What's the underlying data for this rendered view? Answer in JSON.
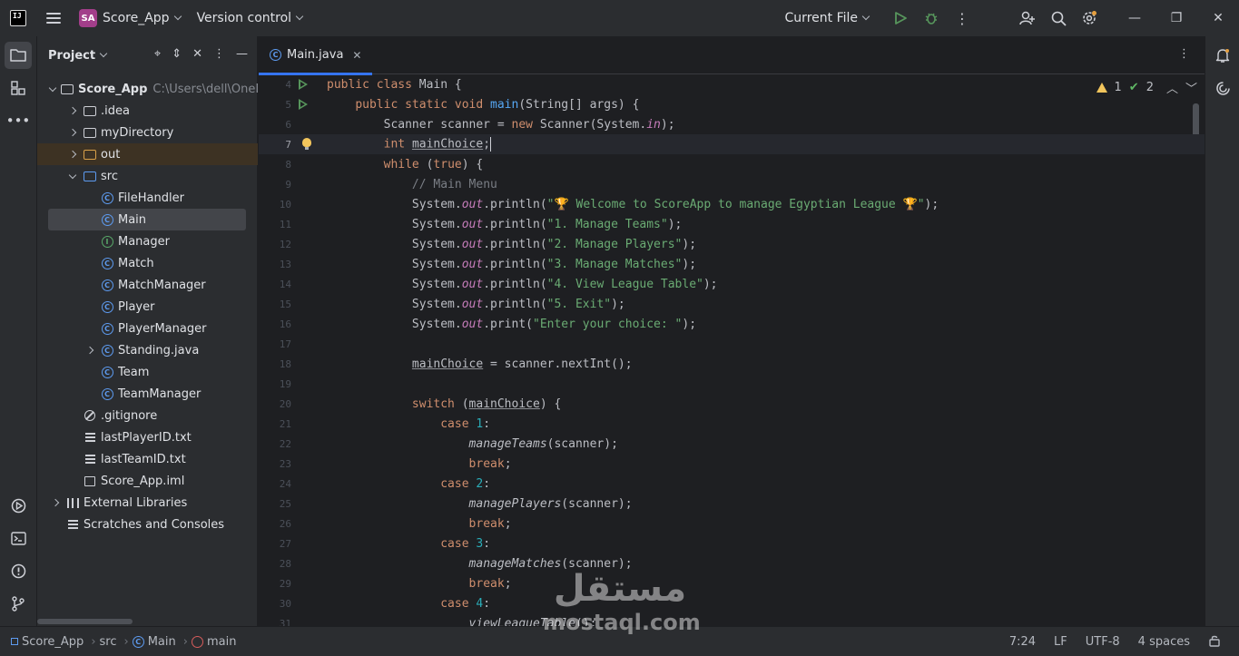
{
  "titlebar": {
    "logo": "IJ",
    "project_badge": "SA",
    "project_name": "Score_App",
    "vcs": "Version control",
    "run_config": "Current File"
  },
  "project_panel": {
    "title": "Project",
    "items": [
      {
        "label": "Score_App",
        "path": "C:\\Users\\dell\\OneD"
      },
      {
        "label": ".idea"
      },
      {
        "label": "myDirectory"
      },
      {
        "label": "out"
      },
      {
        "label": "src"
      },
      {
        "label": "FileHandler"
      },
      {
        "label": "Main"
      },
      {
        "label": "Manager"
      },
      {
        "label": "Match"
      },
      {
        "label": "MatchManager"
      },
      {
        "label": "Player"
      },
      {
        "label": "PlayerManager"
      },
      {
        "label": "Standing.java"
      },
      {
        "label": "Team"
      },
      {
        "label": "TeamManager"
      },
      {
        "label": ".gitignore"
      },
      {
        "label": "lastPlayerID.txt"
      },
      {
        "label": "lastTeamID.txt"
      },
      {
        "label": "Score_App.iml"
      },
      {
        "label": "External Libraries"
      },
      {
        "label": "Scratches and Consoles"
      }
    ]
  },
  "editor": {
    "tab": "Main.java",
    "warnings": "1",
    "checks": "2",
    "line_numbers": [
      "4",
      "5",
      "6",
      "7",
      "8",
      "9",
      "10",
      "11",
      "12",
      "13",
      "14",
      "15",
      "16",
      "17",
      "18",
      "19",
      "20",
      "21",
      "22",
      "23",
      "24",
      "25",
      "26",
      "27",
      "28",
      "29",
      "30",
      "31"
    ]
  },
  "status": {
    "crumbs": [
      "Score_App",
      "src",
      "Main",
      "main"
    ],
    "position": "7:24",
    "line_sep": "LF",
    "encoding": "UTF-8",
    "indent": "4 spaces"
  },
  "watermark": {
    "arabic": "مستقل",
    "latin": "mostaql.com"
  },
  "colors": {
    "accent": "#3574f0",
    "badge": "#a23e8a",
    "run": "#57965c"
  }
}
